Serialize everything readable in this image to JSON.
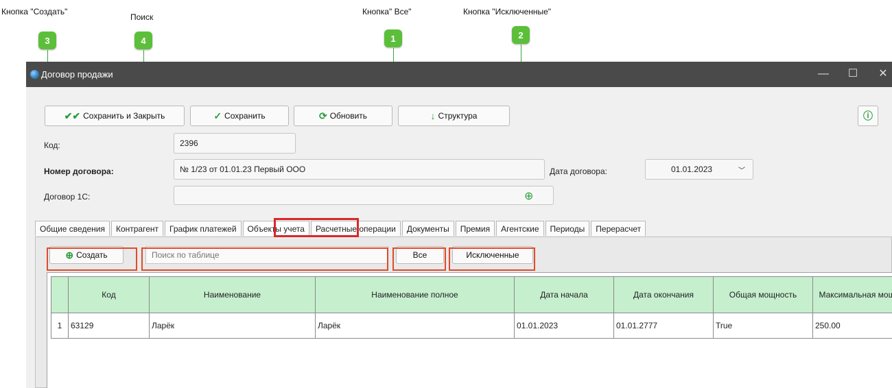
{
  "callouts": {
    "create": {
      "label": "Кнопка \"Создать\"",
      "number": "3"
    },
    "search": {
      "label": "Поиск",
      "number": "4"
    },
    "all": {
      "label": "Кнопка\" Все\"",
      "number": "1"
    },
    "excluded": {
      "label": "Кнопка \"Исключенные\"",
      "number": "2"
    }
  },
  "window": {
    "title": "Договор продажи",
    "controls": {
      "minimize": "—",
      "maximize": "☐",
      "close": "✕"
    }
  },
  "toolbar": {
    "save_close": "Сохранить и Закрыть",
    "save": "Сохранить",
    "refresh": "Обновить",
    "structure": "Структура",
    "info_icon": "ⓘ"
  },
  "form": {
    "code_label": "Код:",
    "code_value": "2396",
    "contract_number_label": "Номер договора:",
    "contract_number_value": "№ 1/23 от 01.01.23 Первый ООО",
    "contract_date_label": "Дата договора:",
    "contract_date_value": "01.01.2023",
    "contract_1c_label": "Договор 1С:",
    "contract_1c_value": ""
  },
  "tabs": [
    {
      "label": "Общие сведения"
    },
    {
      "label": "Контрагент"
    },
    {
      "label": "График платежей"
    },
    {
      "label": "Объекты учета"
    },
    {
      "label": "Расчетные операции"
    },
    {
      "label": "Документы"
    },
    {
      "label": "Премия"
    },
    {
      "label": "Агентские"
    },
    {
      "label": "Периоды"
    },
    {
      "label": "Перерасчет"
    }
  ],
  "objects_tab": {
    "create_label": "Создать",
    "search_placeholder": "Поиск по таблице",
    "all_label": "Все",
    "excluded_label": "Исключенные"
  },
  "table": {
    "columns": [
      "Код",
      "Наименование",
      "Наименование полное",
      "Дата начала",
      "Дата окончания",
      "Общая мощность",
      "Максимальная мощность"
    ],
    "rows": [
      {
        "num": "1",
        "cells": [
          "63129",
          "Ларёк",
          "Ларёк",
          "01.01.2023",
          "01.01.2777",
          "True",
          "250.00"
        ]
      }
    ]
  },
  "colors": {
    "accent_green": "#2b9d3a",
    "badge_green": "#5cbf3a",
    "highlight_red": "#e04b2a",
    "header_green": "#c6efce"
  }
}
